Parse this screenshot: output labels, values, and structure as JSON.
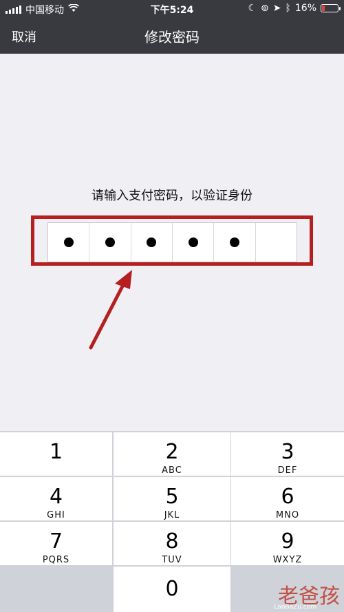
{
  "status_bar": {
    "carrier": "中国移动",
    "time": "下午5:24",
    "battery_percent": "16%",
    "battery_level": 0.16
  },
  "nav": {
    "cancel_label": "取消",
    "title": "修改密码"
  },
  "prompt": "请输入支付密码，以验证身份",
  "pin": {
    "total_digits": 6,
    "entered_digits": 5
  },
  "keypad": {
    "keys": [
      {
        "digit": "1",
        "letters": ""
      },
      {
        "digit": "2",
        "letters": "ABC"
      },
      {
        "digit": "3",
        "letters": "DEF"
      },
      {
        "digit": "4",
        "letters": "GHI"
      },
      {
        "digit": "5",
        "letters": "JKL"
      },
      {
        "digit": "6",
        "letters": "MNO"
      },
      {
        "digit": "7",
        "letters": "PQRS"
      },
      {
        "digit": "8",
        "letters": "TUV"
      },
      {
        "digit": "9",
        "letters": "WXYZ"
      },
      {
        "digit": "0",
        "letters": ""
      }
    ]
  },
  "watermark": {
    "logo_text": "老爸孩",
    "url_text": "LaoBaZu.com"
  },
  "colors": {
    "nav_bg": "#393a3f",
    "highlight": "#b51f1f",
    "page_bg": "#efeff4"
  }
}
